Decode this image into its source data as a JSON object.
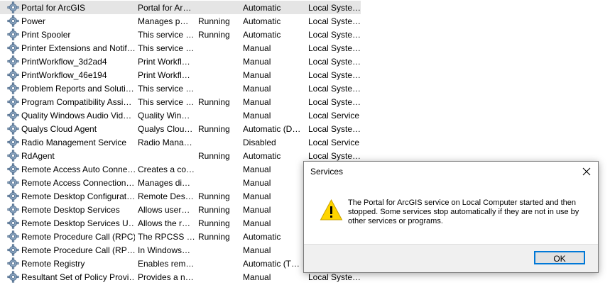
{
  "services": [
    {
      "name": "Portal for ArcGIS",
      "description": "Portal for Ar…",
      "status": "",
      "startup": "Automatic",
      "logon": "Local Syste…",
      "selected": true
    },
    {
      "name": "Power",
      "description": "Manages p…",
      "status": "Running",
      "startup": "Automatic",
      "logon": "Local Syste…"
    },
    {
      "name": "Print Spooler",
      "description": "This service …",
      "status": "Running",
      "startup": "Automatic",
      "logon": "Local Syste…"
    },
    {
      "name": "Printer Extensions and Notif…",
      "description": "This service …",
      "status": "",
      "startup": "Manual",
      "logon": "Local Syste…"
    },
    {
      "name": "PrintWorkflow_3d2ad4",
      "description": "Print Workfl…",
      "status": "",
      "startup": "Manual",
      "logon": "Local Syste…"
    },
    {
      "name": "PrintWorkflow_46e194",
      "description": "Print Workfl…",
      "status": "",
      "startup": "Manual",
      "logon": "Local Syste…"
    },
    {
      "name": "Problem Reports and Soluti…",
      "description": "This service …",
      "status": "",
      "startup": "Manual",
      "logon": "Local Syste…"
    },
    {
      "name": "Program Compatibility Assi…",
      "description": "This service …",
      "status": "Running",
      "startup": "Manual",
      "logon": "Local Syste…"
    },
    {
      "name": "Quality Windows Audio Vid…",
      "description": "Quality Win…",
      "status": "",
      "startup": "Manual",
      "logon": "Local Service"
    },
    {
      "name": "Qualys Cloud Agent",
      "description": "Qualys Clou…",
      "status": "Running",
      "startup": "Automatic (D…",
      "logon": "Local Syste…"
    },
    {
      "name": "Radio Management Service",
      "description": "Radio Mana…",
      "status": "",
      "startup": "Disabled",
      "logon": "Local Service"
    },
    {
      "name": "RdAgent",
      "description": "",
      "status": "Running",
      "startup": "Automatic",
      "logon": "Local Syste…"
    },
    {
      "name": "Remote Access Auto Conne…",
      "description": "Creates a co…",
      "status": "",
      "startup": "Manual",
      "logon": ""
    },
    {
      "name": "Remote Access Connection…",
      "description": "Manages di…",
      "status": "",
      "startup": "Manual",
      "logon": ""
    },
    {
      "name": "Remote Desktop Configurat…",
      "description": "Remote Des…",
      "status": "Running",
      "startup": "Manual",
      "logon": ""
    },
    {
      "name": "Remote Desktop Services",
      "description": "Allows user…",
      "status": "Running",
      "startup": "Manual",
      "logon": ""
    },
    {
      "name": "Remote Desktop Services U…",
      "description": "Allows the r…",
      "status": "Running",
      "startup": "Manual",
      "logon": ""
    },
    {
      "name": "Remote Procedure Call (RPC)",
      "description": "The RPCSS …",
      "status": "Running",
      "startup": "Automatic",
      "logon": ""
    },
    {
      "name": "Remote Procedure Call (RP…",
      "description": "In Windows…",
      "status": "",
      "startup": "Manual",
      "logon": ""
    },
    {
      "name": "Remote Registry",
      "description": "Enables rem…",
      "status": "",
      "startup": "Automatic (T…",
      "logon": ""
    },
    {
      "name": "Resultant Set of Policy Provi…",
      "description": "Provides a n…",
      "status": "",
      "startup": "Manual",
      "logon": "Local Syste…"
    }
  ],
  "dialog": {
    "title": "Services",
    "message": "The Portal for ArcGIS service on Local Computer started and then stopped. Some services stop automatically if they are not in use by other services or programs.",
    "ok_label": "OK",
    "close_icon": "close-icon",
    "warning_icon": "warning-icon"
  },
  "colors": {
    "selected_row": "#e5e5e5",
    "warning_fill": "#ffd500",
    "button_border": "#0078d7"
  }
}
